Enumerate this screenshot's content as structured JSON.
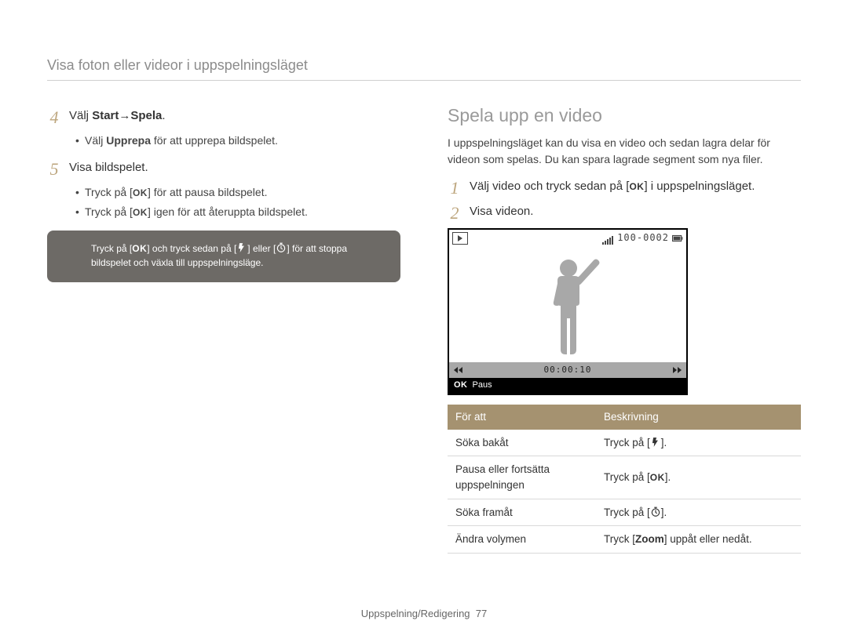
{
  "header": "Visa foton eller videor i uppspelningsläget",
  "left": {
    "step4_prefix": "Välj ",
    "step4_b1": "Start",
    "step4_arrow": " → ",
    "step4_b2": "Spela",
    "step4_suffix": ".",
    "step4_bullets": [
      {
        "pre": "Välj ",
        "bold": "Upprepa",
        "post": " för att upprepa bildspelet."
      }
    ],
    "step5": "Visa bildspelet.",
    "step5_bullets": [
      {
        "pre": "Tryck på [",
        "ok": "OK",
        "post": "] för att pausa bildspelet."
      },
      {
        "pre": "Tryck på [",
        "ok": "OK",
        "post": "] igen för att återuppta bildspelet."
      }
    ],
    "note_pre": "Tryck på [",
    "note_ok": "OK",
    "note_mid1": "] och tryck sedan på [",
    "note_mid2": "] eller [",
    "note_mid3": "] för att stoppa bildspelet och växla till uppspelningsläge."
  },
  "right": {
    "title": "Spela upp en video",
    "intro": "I uppspelningsläget kan du visa en video och sedan lagra delar för videon som spelas. Du kan spara lagrade segment som nya filer.",
    "step1_pre": "Välj video och tryck sedan på [",
    "step1_ok": "OK",
    "step1_post": "] i uppspelningsläget.",
    "step2": "Visa videon.",
    "vb_counter": "100-0002",
    "vb_time": "00:00:10",
    "vb_pause_ok": "OK",
    "vb_pause_label": "Paus",
    "table": {
      "h1": "För att",
      "h2": "Beskrivning",
      "rows": [
        {
          "c1": "Söka bakåt",
          "pre": "Tryck på [",
          "icon": "flash",
          "post": "]."
        },
        {
          "c1": "Pausa eller fortsätta uppspelningen",
          "pre": "Tryck på [",
          "icon": "ok",
          "post": "]."
        },
        {
          "c1": "Söka framåt",
          "pre": "Tryck på [",
          "icon": "timer",
          "post": "]."
        },
        {
          "c1": "Ändra volymen",
          "pre": "Tryck [",
          "bold": "Zoom",
          "post": "] uppåt eller nedåt."
        }
      ]
    }
  },
  "footer_label": "Uppspelning/Redigering",
  "footer_page": "77",
  "icons": {
    "flash": "flash-icon",
    "timer": "timer-icon",
    "battery": "battery-icon"
  }
}
